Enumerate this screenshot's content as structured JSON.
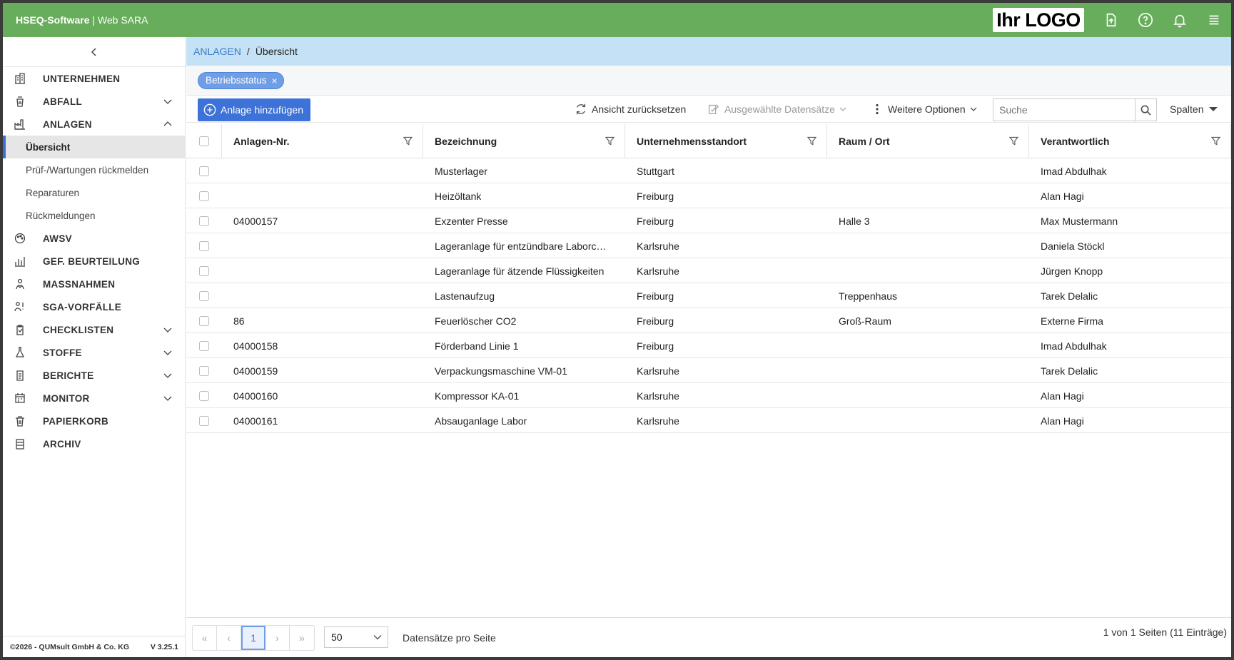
{
  "header": {
    "brand_bold": "HSEQ-Software",
    "brand_sep": " | ",
    "brand_rest": "Web SARA",
    "logo_text": "Ihr LOGO",
    "colors": {
      "bar": "#67ad5b",
      "accent": "#3d72d9"
    }
  },
  "sidebar": {
    "items": [
      {
        "label": "UNTERNEHMEN",
        "icon": "building-icon",
        "chevron": ""
      },
      {
        "label": "ABFALL",
        "icon": "trash-bag-icon",
        "chevron": "down"
      },
      {
        "label": "ANLAGEN",
        "icon": "factory-icon",
        "chevron": "up"
      },
      {
        "label": "AWSV",
        "icon": "palette-icon",
        "chevron": ""
      },
      {
        "label": "GEF. BEURTEILUNG",
        "icon": "chart-icon",
        "chevron": ""
      },
      {
        "label": "MASSNAHMEN",
        "icon": "people-icon",
        "chevron": ""
      },
      {
        "label": "SGA-VORFÄLLE",
        "icon": "person-alert-icon",
        "chevron": ""
      },
      {
        "label": "CHECKLISTEN",
        "icon": "clipboard-check-icon",
        "chevron": "down"
      },
      {
        "label": "STOFFE",
        "icon": "flask-icon",
        "chevron": "down"
      },
      {
        "label": "BERICHTE",
        "icon": "report-icon",
        "chevron": "down"
      },
      {
        "label": "MONITOR",
        "icon": "calendar-icon",
        "chevron": "down"
      },
      {
        "label": "PAPIERKORB",
        "icon": "bin-icon",
        "chevron": ""
      },
      {
        "label": "ARCHIV",
        "icon": "archive-icon",
        "chevron": ""
      }
    ],
    "subitems": [
      {
        "label": "Übersicht",
        "active": true
      },
      {
        "label": "Prüf-/Wartungen rückmelden"
      },
      {
        "label": "Reparaturen"
      },
      {
        "label": "Rückmeldungen"
      }
    ],
    "footer_left": "©2026 - QUMsult GmbH & Co. KG",
    "footer_right": "V 3.25.1"
  },
  "breadcrumb": {
    "link": "ANLAGEN",
    "separator": "/",
    "current": "Übersicht"
  },
  "filter": {
    "chip": "Betriebsstatus",
    "chip_close": "×"
  },
  "toolbar": {
    "add": "Anlage hinzufügen",
    "reset": "Ansicht zurücksetzen",
    "selected": "Ausgewählte Datensätze",
    "more": "Weitere Optionen",
    "search_placeholder": "Suche",
    "columns": "Spalten"
  },
  "table": {
    "columns": [
      "Anlagen-Nr.",
      "Bezeichnung",
      "Unternehmensstandort",
      "Raum / Ort",
      "Verantwortlich"
    ],
    "rows": [
      [
        "",
        "Musterlager",
        "Stuttgart",
        "",
        "Imad Abdulhak"
      ],
      [
        "",
        "Heizöltank",
        "Freiburg",
        "",
        "Alan Hagi"
      ],
      [
        "04000157",
        "Exzenter Presse",
        "Freiburg",
        "Halle 3",
        "Max Mustermann"
      ],
      [
        "",
        "Lageranlage für entzündbare Laborchemikalien",
        "Karlsruhe",
        "",
        "Daniela Stöckl"
      ],
      [
        "",
        "Lageranlage für ätzende Flüssigkeiten",
        "Karlsruhe",
        "",
        "Jürgen Knopp"
      ],
      [
        "",
        "Lastenaufzug",
        "Freiburg",
        "Treppenhaus",
        "Tarek Delalic"
      ],
      [
        "86",
        "Feuerlöscher CO2",
        "Freiburg",
        "Groß-Raum",
        "Externe Firma"
      ],
      [
        "04000158",
        "Förderband Linie 1",
        "Freiburg",
        "",
        "Imad Abdulhak"
      ],
      [
        "04000159",
        "Verpackungsmaschine VM-01",
        "Karlsruhe",
        "",
        "Tarek Delalic"
      ],
      [
        "04000160",
        "Kompressor KA-01",
        "Karlsruhe",
        "",
        "Alan Hagi"
      ],
      [
        "04000161",
        "Absauganlage Labor",
        "Karlsruhe",
        "",
        "Alan Hagi"
      ]
    ]
  },
  "pager": {
    "first": "«",
    "prev": "‹",
    "page": "1",
    "next": "›",
    "last": "»",
    "size": "50",
    "per_page_label": "Datensätze pro Seite",
    "info": "1 von 1 Seiten (11 Einträge)"
  }
}
